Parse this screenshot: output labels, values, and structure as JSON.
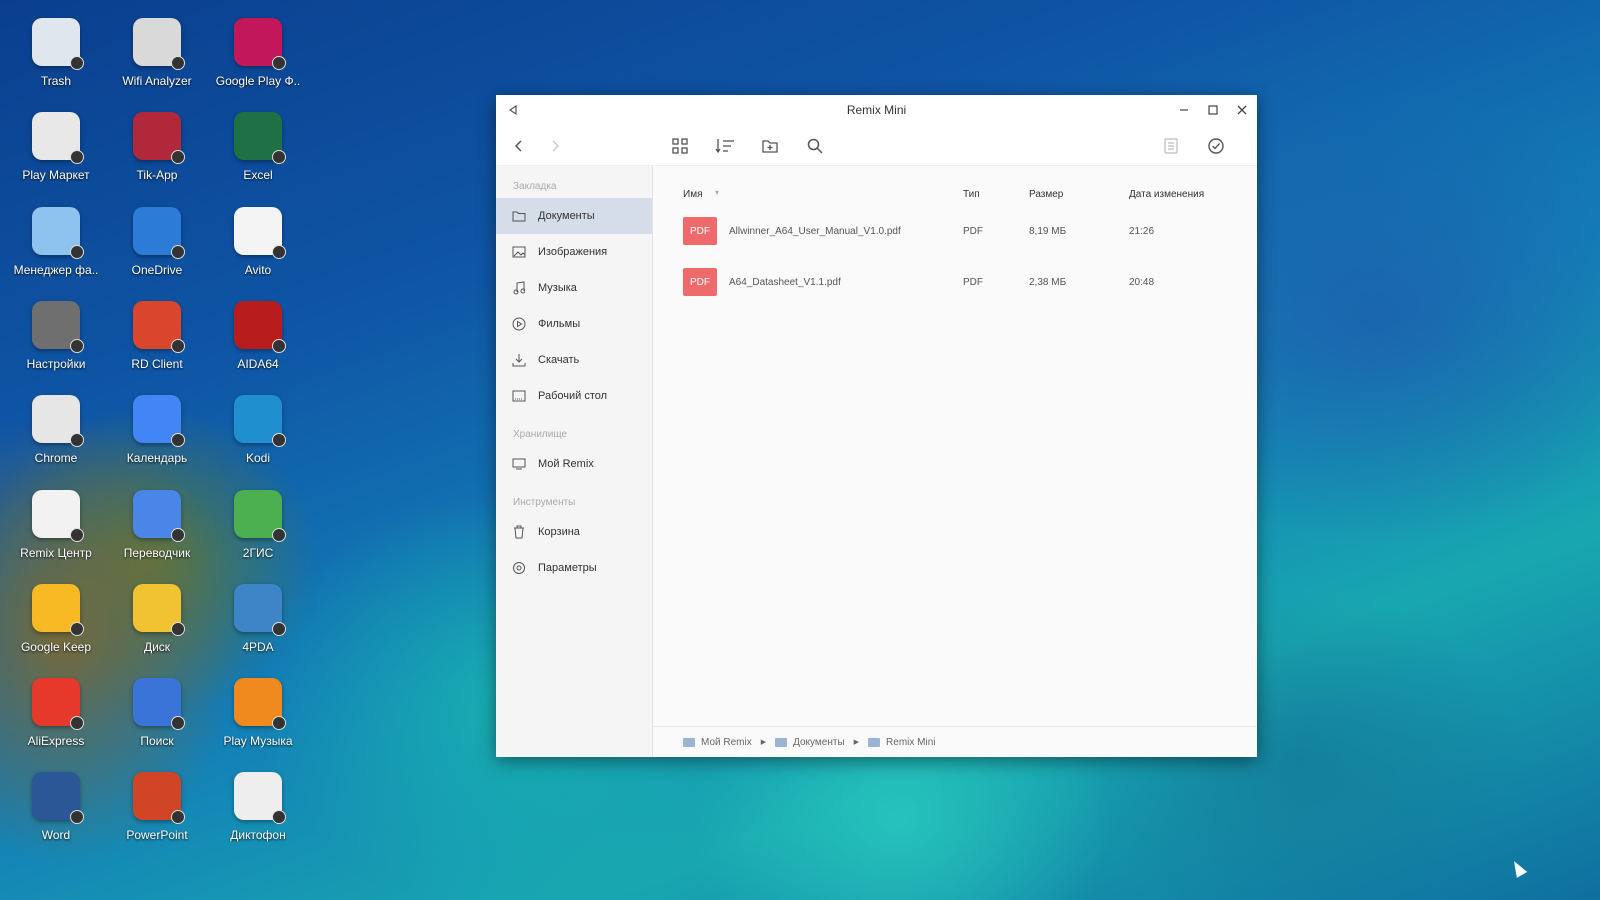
{
  "desktop": {
    "icons": [
      {
        "label": "Trash",
        "icon": "trash-icon",
        "color": "#dfe6ee"
      },
      {
        "label": "Wifi Analyzer",
        "icon": "wifi-analyzer-icon",
        "color": "#d9d9d9"
      },
      {
        "label": "Google Play Ф..",
        "icon": "google-play-movies-icon",
        "color": "#c2185b"
      },
      {
        "label": "Play Маркет",
        "icon": "play-market-icon",
        "color": "#e8e8e8"
      },
      {
        "label": "Tik-App",
        "icon": "tik-app-icon",
        "color": "#b0283a"
      },
      {
        "label": "Excel",
        "icon": "excel-icon",
        "color": "#1e7145"
      },
      {
        "label": "Менеджер фа..",
        "icon": "file-manager-icon",
        "color": "#8fc3ef"
      },
      {
        "label": "OneDrive",
        "icon": "onedrive-icon",
        "color": "#2c7bd6"
      },
      {
        "label": "Avito",
        "icon": "avito-icon",
        "color": "#f4f4f4"
      },
      {
        "label": "Настройки",
        "icon": "settings-icon",
        "color": "#6f6f6f"
      },
      {
        "label": "RD Client",
        "icon": "rd-client-icon",
        "color": "#d9452d"
      },
      {
        "label": "AIDA64",
        "icon": "aida64-icon",
        "color": "#b81d1d"
      },
      {
        "label": "Chrome",
        "icon": "chrome-icon",
        "color": "#e6e6e6"
      },
      {
        "label": "Календарь",
        "icon": "calendar-icon",
        "color": "#4285f4"
      },
      {
        "label": "Kodi",
        "icon": "kodi-icon",
        "color": "#1f8fd0"
      },
      {
        "label": "Remix Центр",
        "icon": "remix-center-icon",
        "color": "#f2f2f2"
      },
      {
        "label": "Переводчик",
        "icon": "translate-icon",
        "color": "#4a86e8"
      },
      {
        "label": "2ГИС",
        "icon": "2gis-icon",
        "color": "#4caf50"
      },
      {
        "label": "Google Keep",
        "icon": "google-keep-icon",
        "color": "#f7b924"
      },
      {
        "label": "Диск",
        "icon": "google-drive-icon",
        "color": "#f1c232"
      },
      {
        "label": "4PDA",
        "icon": "4pda-icon",
        "color": "#3d85c6"
      },
      {
        "label": "AliExpress",
        "icon": "aliexpress-icon",
        "color": "#e6382b"
      },
      {
        "label": "Поиск",
        "icon": "voice-search-icon",
        "color": "#3b74d8"
      },
      {
        "label": "Play Музыка",
        "icon": "play-music-icon",
        "color": "#f18a1e"
      },
      {
        "label": "Word",
        "icon": "word-icon",
        "color": "#2b5797"
      },
      {
        "label": "PowerPoint",
        "icon": "powerpoint-icon",
        "color": "#d04525"
      },
      {
        "label": "Диктофон",
        "icon": "recorder-icon",
        "color": "#eeeeee"
      }
    ]
  },
  "window": {
    "title": "Remix Mini",
    "sidebar": {
      "sections": [
        "Закладка",
        "Хранилище",
        "Инструменты"
      ],
      "bookmarks": [
        "Документы",
        "Изображения",
        "Музыка",
        "Фильмы",
        "Скачать",
        "Рабочий стол"
      ],
      "storage": [
        "Мой Remix"
      ],
      "tools": [
        "Корзина",
        "Параметры"
      ]
    },
    "columns": {
      "name": "Имя",
      "type": "Тип",
      "size": "Размер",
      "modified": "Дата изменения"
    },
    "files": [
      {
        "badge": "PDF",
        "name": "Allwinner_A64_User_Manual_V1.0.pdf",
        "type": "PDF",
        "size": "8,19 МБ",
        "modified": "21:26"
      },
      {
        "badge": "PDF",
        "name": "A64_Datasheet_V1.1.pdf",
        "type": "PDF",
        "size": "2,38 МБ",
        "modified": "20:48"
      }
    ],
    "breadcrumb": [
      "Мой Remix",
      "Документы",
      "Remix Mini"
    ]
  },
  "colors": {
    "selection": "#d5dde8",
    "pdf_badge": "#ef6b6b",
    "folder": "#9ab4d4"
  }
}
